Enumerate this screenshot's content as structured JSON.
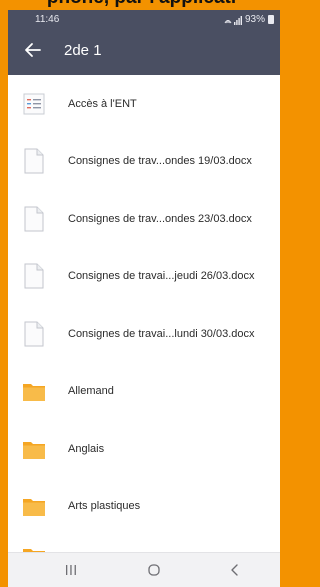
{
  "banner": {
    "text": "phone, par l'applicati"
  },
  "status": {
    "time": "11:46",
    "battery": "93%"
  },
  "header": {
    "title": "2de 1",
    "back_icon": "arrow-left-icon"
  },
  "items": [
    {
      "label": "Accès à l'ENT",
      "icon": "ent-link-icon"
    },
    {
      "label": "Consignes de trav...ondes 19/03.docx",
      "icon": "document-icon"
    },
    {
      "label": "Consignes de trav...ondes 23/03.docx",
      "icon": "document-icon"
    },
    {
      "label": "Consignes de travai...jeudi 26/03.docx",
      "icon": "document-icon"
    },
    {
      "label": "Consignes de travai...lundi 30/03.docx",
      "icon": "document-icon"
    },
    {
      "label": "Allemand",
      "icon": "folder-icon"
    },
    {
      "label": "Anglais",
      "icon": "folder-icon"
    },
    {
      "label": "Arts plastiques",
      "icon": "folder-icon"
    }
  ],
  "navbar": {
    "recent": "recent-apps-icon",
    "home": "home-icon",
    "back": "back-chevron-icon"
  },
  "colors": {
    "accent": "#f39200",
    "appbar": "#4a4f62",
    "folder": "#f8bb49"
  }
}
